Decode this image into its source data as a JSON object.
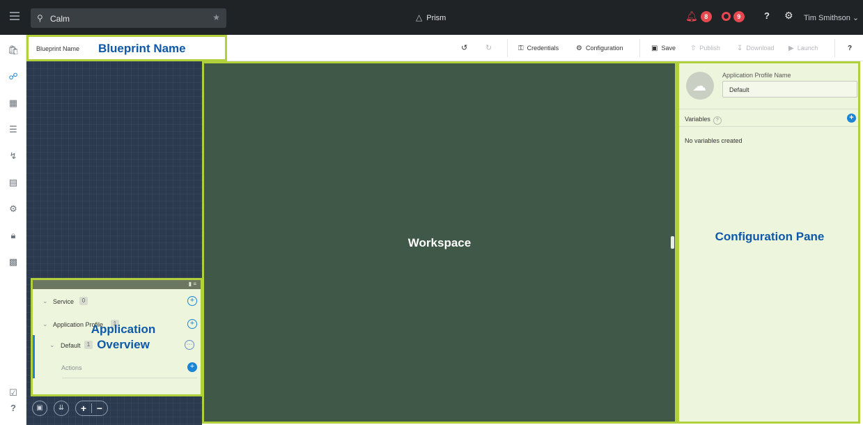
{
  "topbar": {
    "search_value": "Calm",
    "app_name": "Prism",
    "alerts_count": "8",
    "events_count": "9",
    "help_label": "?",
    "user_name": "Tim Smithson"
  },
  "toolbar": {
    "blueprint_name_label": "Blueprint Name",
    "blueprint_name_annotation": "Blueprint Name",
    "credentials": "Credentials",
    "configuration": "Configuration",
    "save": "Save",
    "publish": "Publish",
    "download": "Download",
    "launch": "Launch",
    "help": "?"
  },
  "overview": {
    "annotation": "Application Overview",
    "rows": [
      {
        "label": "Service",
        "count": "0"
      },
      {
        "label": "Application Profile",
        "count": "1"
      },
      {
        "label": "Default",
        "count": "1"
      },
      {
        "label": "Actions"
      }
    ]
  },
  "workspace": {
    "annotation": "Workspace"
  },
  "config": {
    "profile_name_label": "Application Profile Name",
    "profile_name_value": "Default",
    "variables_label": "Variables",
    "variables_help": "?",
    "no_variables": "No variables created",
    "annotation": "Configuration Pane"
  },
  "zoom": {
    "zoom_in": "+",
    "zoom_out": "−"
  },
  "colors": {
    "topbar_bg": "#1f2326",
    "annotation_border": "#b2d03b",
    "annotation_text": "#0d58a8",
    "workspace_bg": "#3f5847",
    "left_panel_bg": "#2b3a4f",
    "accent_blue": "#1b84d4",
    "alert_red": "#e7484f"
  }
}
